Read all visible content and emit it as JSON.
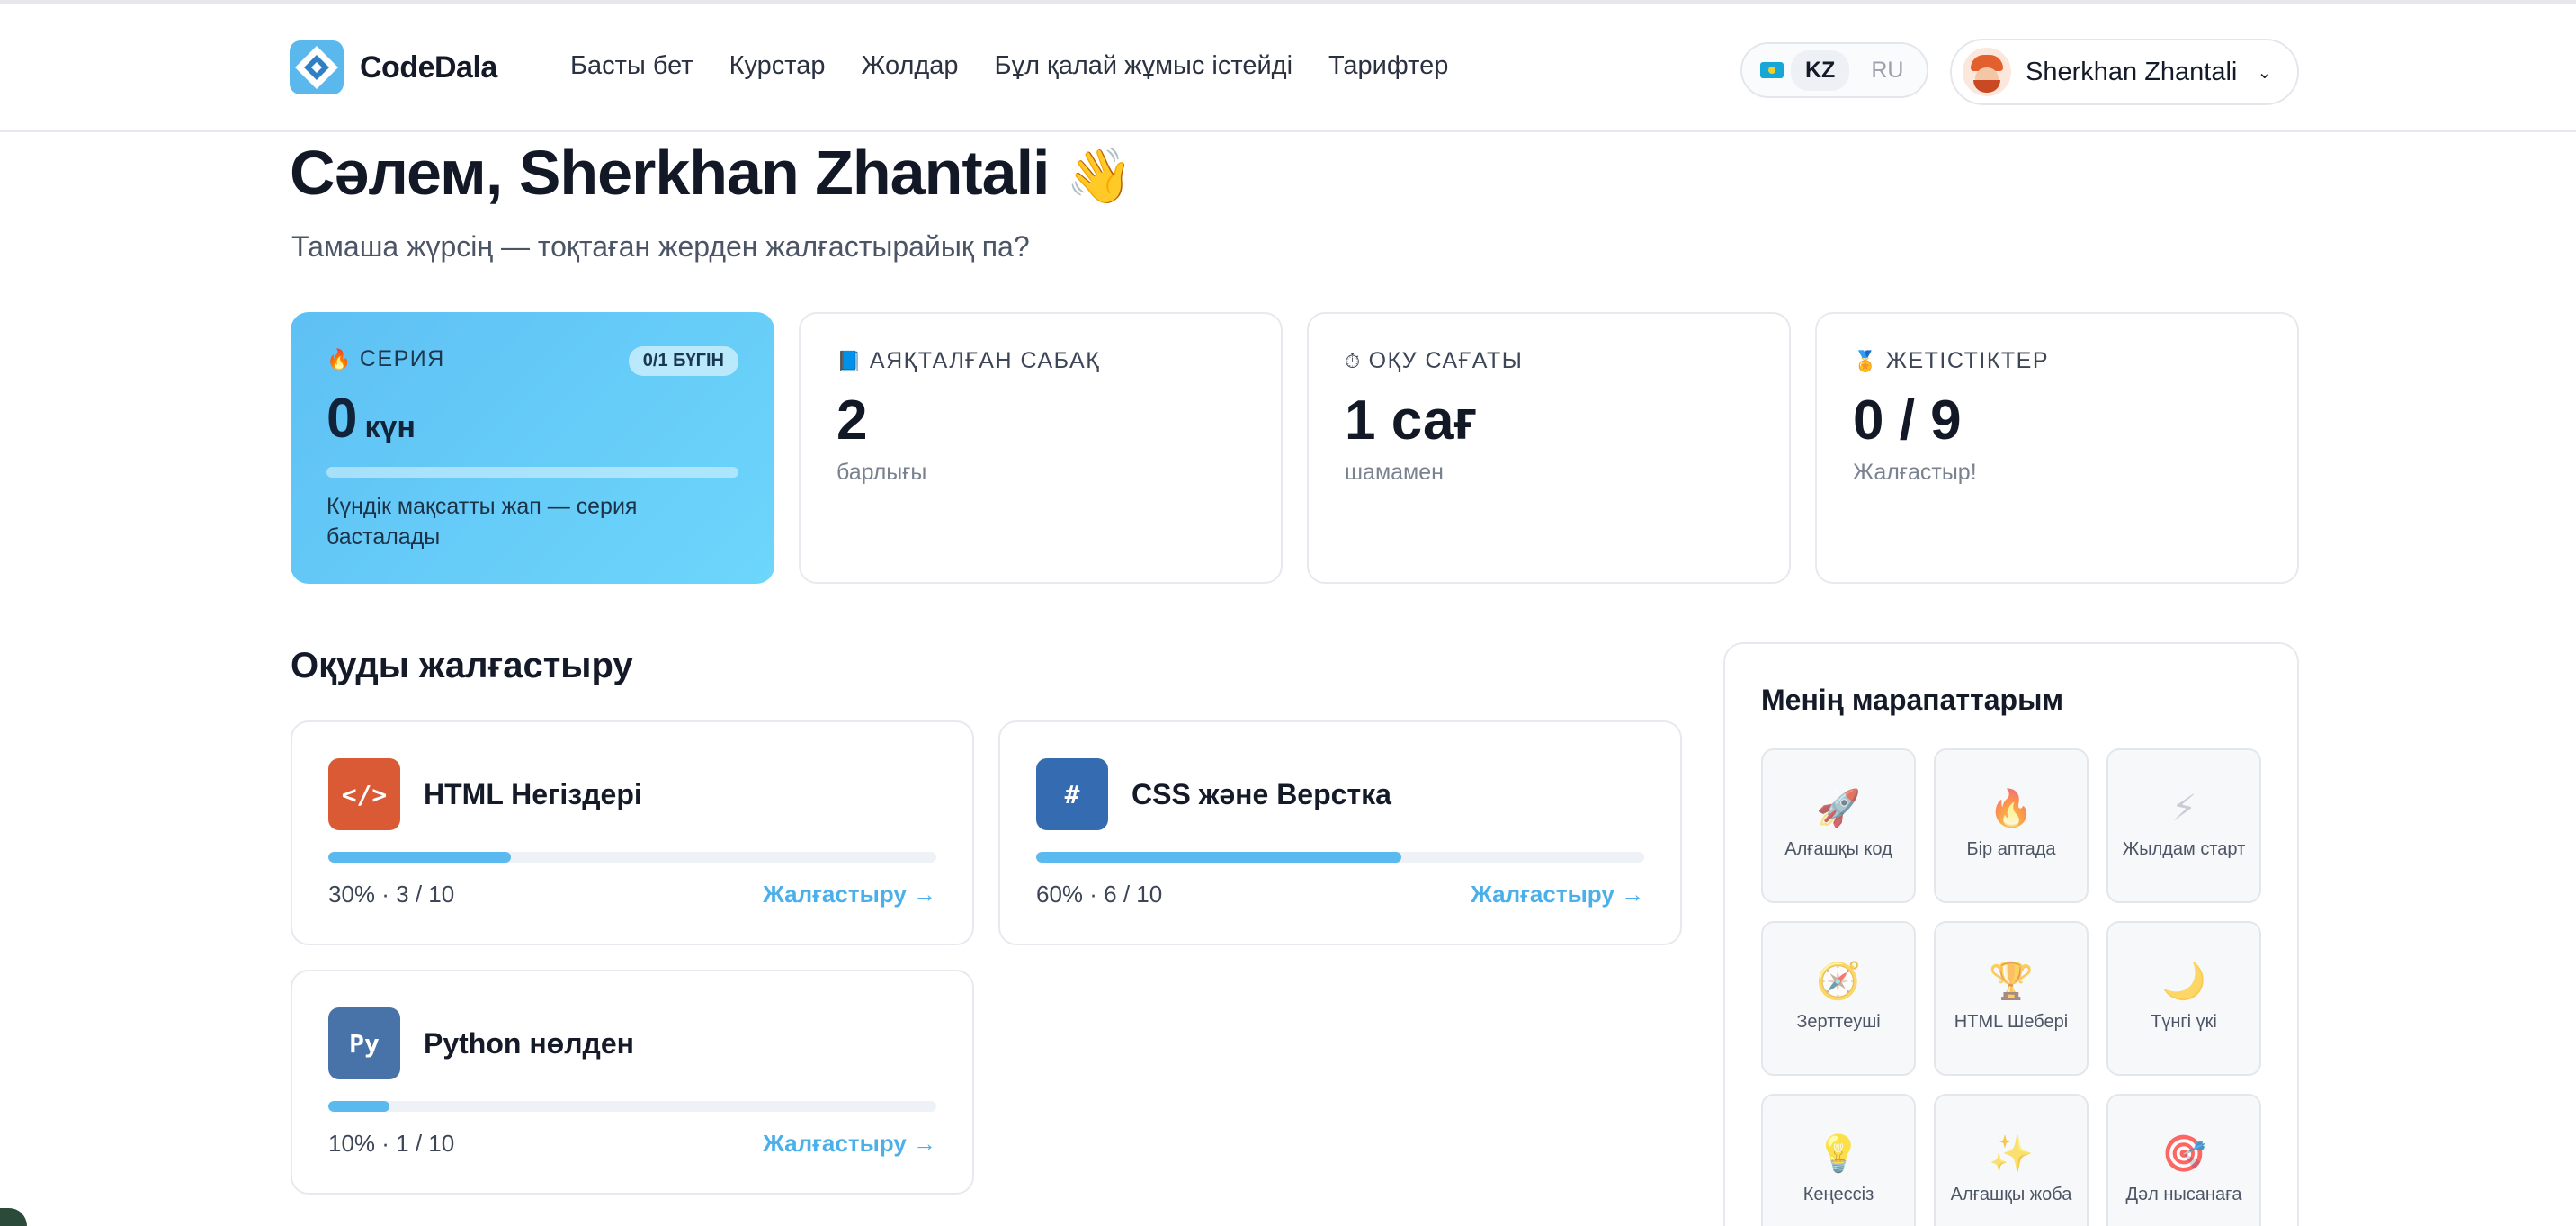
{
  "brand": {
    "name": "CodeDala",
    "accent": "#4bb0ea"
  },
  "nav": {
    "links": [
      "Басты бет",
      "Курстар",
      "Жолдар",
      "Бұл қалай жұмыс істейді",
      "Тарифтер"
    ]
  },
  "lang": {
    "options": [
      "KZ",
      "RU"
    ],
    "active": "KZ",
    "flag_icon": "kazakhstan-flag-icon"
  },
  "user": {
    "name": "Sherkhan Zhantali",
    "avatar_icon": "user-avatar"
  },
  "greeting": {
    "title": "Сәлем, Sherkhan Zhantali",
    "emoji": "👋",
    "subtitle": "Тамаша жүрсің — тоқтаған жерден жалғастырайық па?"
  },
  "stats": {
    "streak": {
      "icon": "🔥",
      "label": "СЕРИЯ",
      "badge": "0/1 БҮГІН",
      "value": "0",
      "unit": "күн",
      "progress": 0,
      "note": "Күндік мақсатты жап — серия басталады"
    },
    "lessons": {
      "icon": "📘",
      "label": "АЯҚТАЛҒАН САБАҚ",
      "value": "2",
      "note": "барлығы"
    },
    "hours": {
      "icon": "⏱",
      "label": "ОҚУ САҒАТЫ",
      "value": "1 сағ",
      "note": "шамамен"
    },
    "achievements": {
      "icon": "🏅",
      "label": "ЖЕТІСТІКТЕР",
      "value": "0 / 9",
      "note": "Жалғастыр!"
    }
  },
  "continue": {
    "title": "Оқуды жалғастыру",
    "courses": [
      {
        "icon_text": "</>",
        "color": "#d95a35",
        "title": "HTML Негіздері",
        "percent": 30,
        "progress_text": "30% · 3 / 10",
        "link": "Жалғастыру →"
      },
      {
        "icon_text": "#",
        "color": "#346bb1",
        "title": "CSS және Верстка",
        "percent": 60,
        "progress_text": "60% · 6 / 10",
        "link": "Жалғастыру →"
      },
      {
        "icon_text": "Py",
        "color": "#4773a8",
        "title": "Python нөлден",
        "percent": 10,
        "progress_text": "10% · 1 / 10",
        "link": "Жалғастыру →"
      }
    ]
  },
  "awards": {
    "title": "Менің марапаттарым",
    "items": [
      {
        "icon": "🚀",
        "name": "Алғашқы код"
      },
      {
        "icon": "🔥",
        "name": "Бір аптада"
      },
      {
        "icon": "⚡",
        "name": "Жылдам старт"
      },
      {
        "icon": "🧭",
        "name": "Зерттеуші"
      },
      {
        "icon": "🏆",
        "name": "HTML Шебері"
      },
      {
        "icon": "🌙",
        "name": "Түнгі үкі"
      },
      {
        "icon": "💡",
        "name": "Кеңессіз"
      },
      {
        "icon": "✨",
        "name": "Алғашқы жоба"
      },
      {
        "icon": "🎯",
        "name": "Дәл нысанаға"
      }
    ]
  }
}
